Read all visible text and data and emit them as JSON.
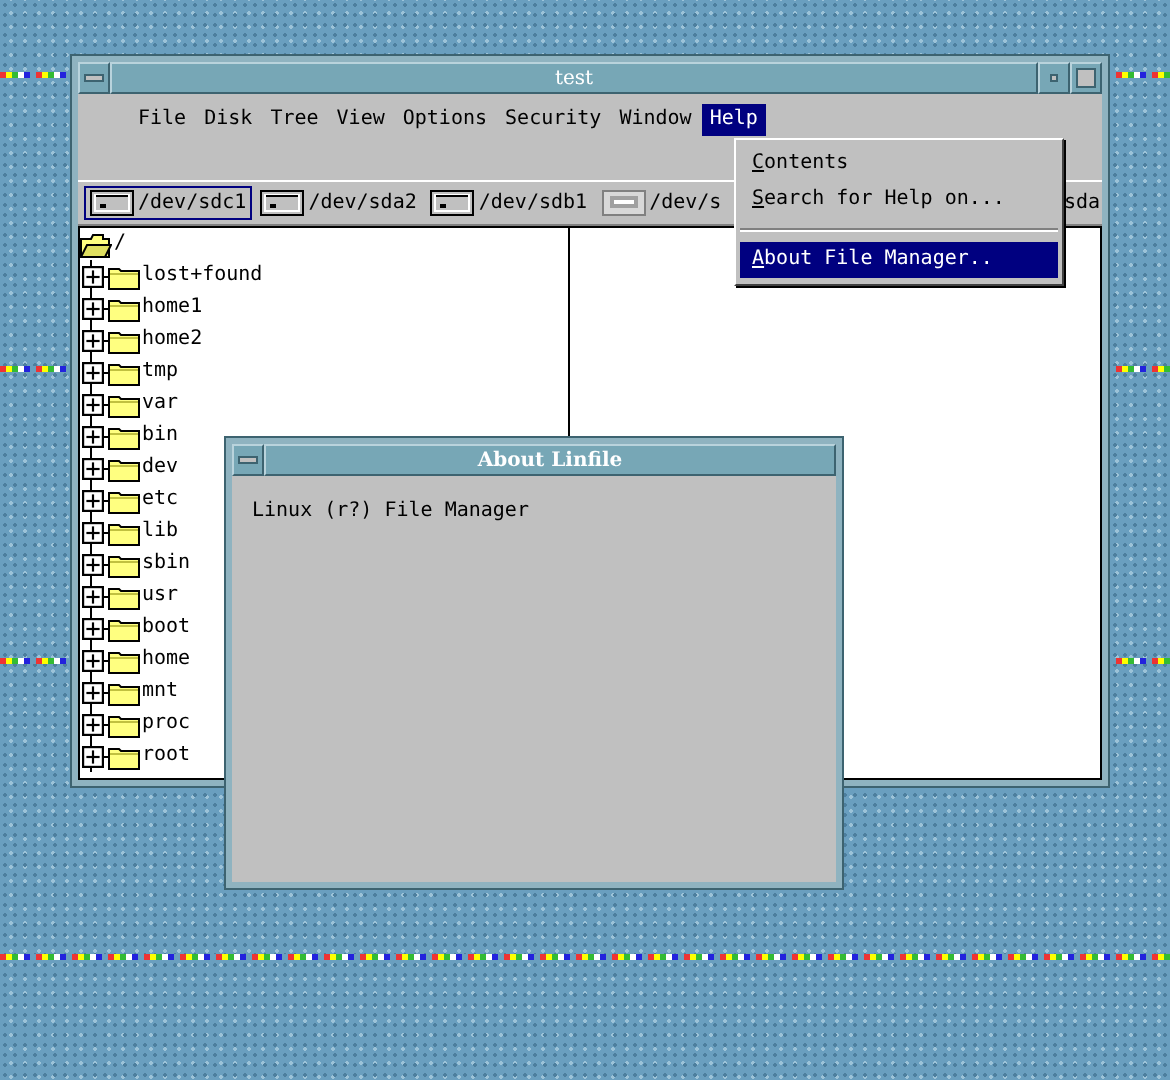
{
  "window": {
    "title": "test"
  },
  "menus": [
    {
      "label": "File",
      "selected": false
    },
    {
      "label": "Disk",
      "selected": false
    },
    {
      "label": "Tree",
      "selected": false
    },
    {
      "label": "View",
      "selected": false
    },
    {
      "label": "Options",
      "selected": false
    },
    {
      "label": "Security",
      "selected": false
    },
    {
      "label": "Window",
      "selected": false
    },
    {
      "label": "Help",
      "selected": true
    }
  ],
  "help_menu": {
    "items": [
      {
        "label": "Contents",
        "selected": false
      },
      {
        "label": "Search for Help on...",
        "selected": false
      },
      {
        "label": "About File Manager..",
        "selected": true,
        "separator_before": true
      }
    ]
  },
  "drives": [
    {
      "label": "/dev/sdc1",
      "kind": "disk",
      "selected": true
    },
    {
      "label": "/dev/sda2",
      "kind": "disk",
      "selected": false
    },
    {
      "label": "/dev/sdb1",
      "kind": "disk",
      "selected": false
    },
    {
      "label": "/dev/s",
      "kind": "removable",
      "selected": false
    },
    {
      "label": "sda",
      "kind": "hidden",
      "selected": false
    }
  ],
  "tree": {
    "label": "/",
    "expanded": true,
    "children": [
      {
        "label": "lost+found",
        "expanded": false
      },
      {
        "label": "home1",
        "expanded": false
      },
      {
        "label": "home2",
        "expanded": false
      },
      {
        "label": "tmp",
        "expanded": false
      },
      {
        "label": "var",
        "expanded": false
      },
      {
        "label": "bin",
        "expanded": false
      },
      {
        "label": "dev",
        "expanded": false
      },
      {
        "label": "etc",
        "expanded": false
      },
      {
        "label": "lib",
        "expanded": false
      },
      {
        "label": "sbin",
        "expanded": false
      },
      {
        "label": "usr",
        "expanded": false
      },
      {
        "label": "boot",
        "expanded": false
      },
      {
        "label": "home",
        "expanded": false
      },
      {
        "label": "mnt",
        "expanded": false
      },
      {
        "label": "proc",
        "expanded": false
      },
      {
        "label": "root",
        "expanded": false
      }
    ]
  },
  "about_dialog": {
    "title": "About Linfile",
    "text": "Linux (r?) File Manager"
  }
}
